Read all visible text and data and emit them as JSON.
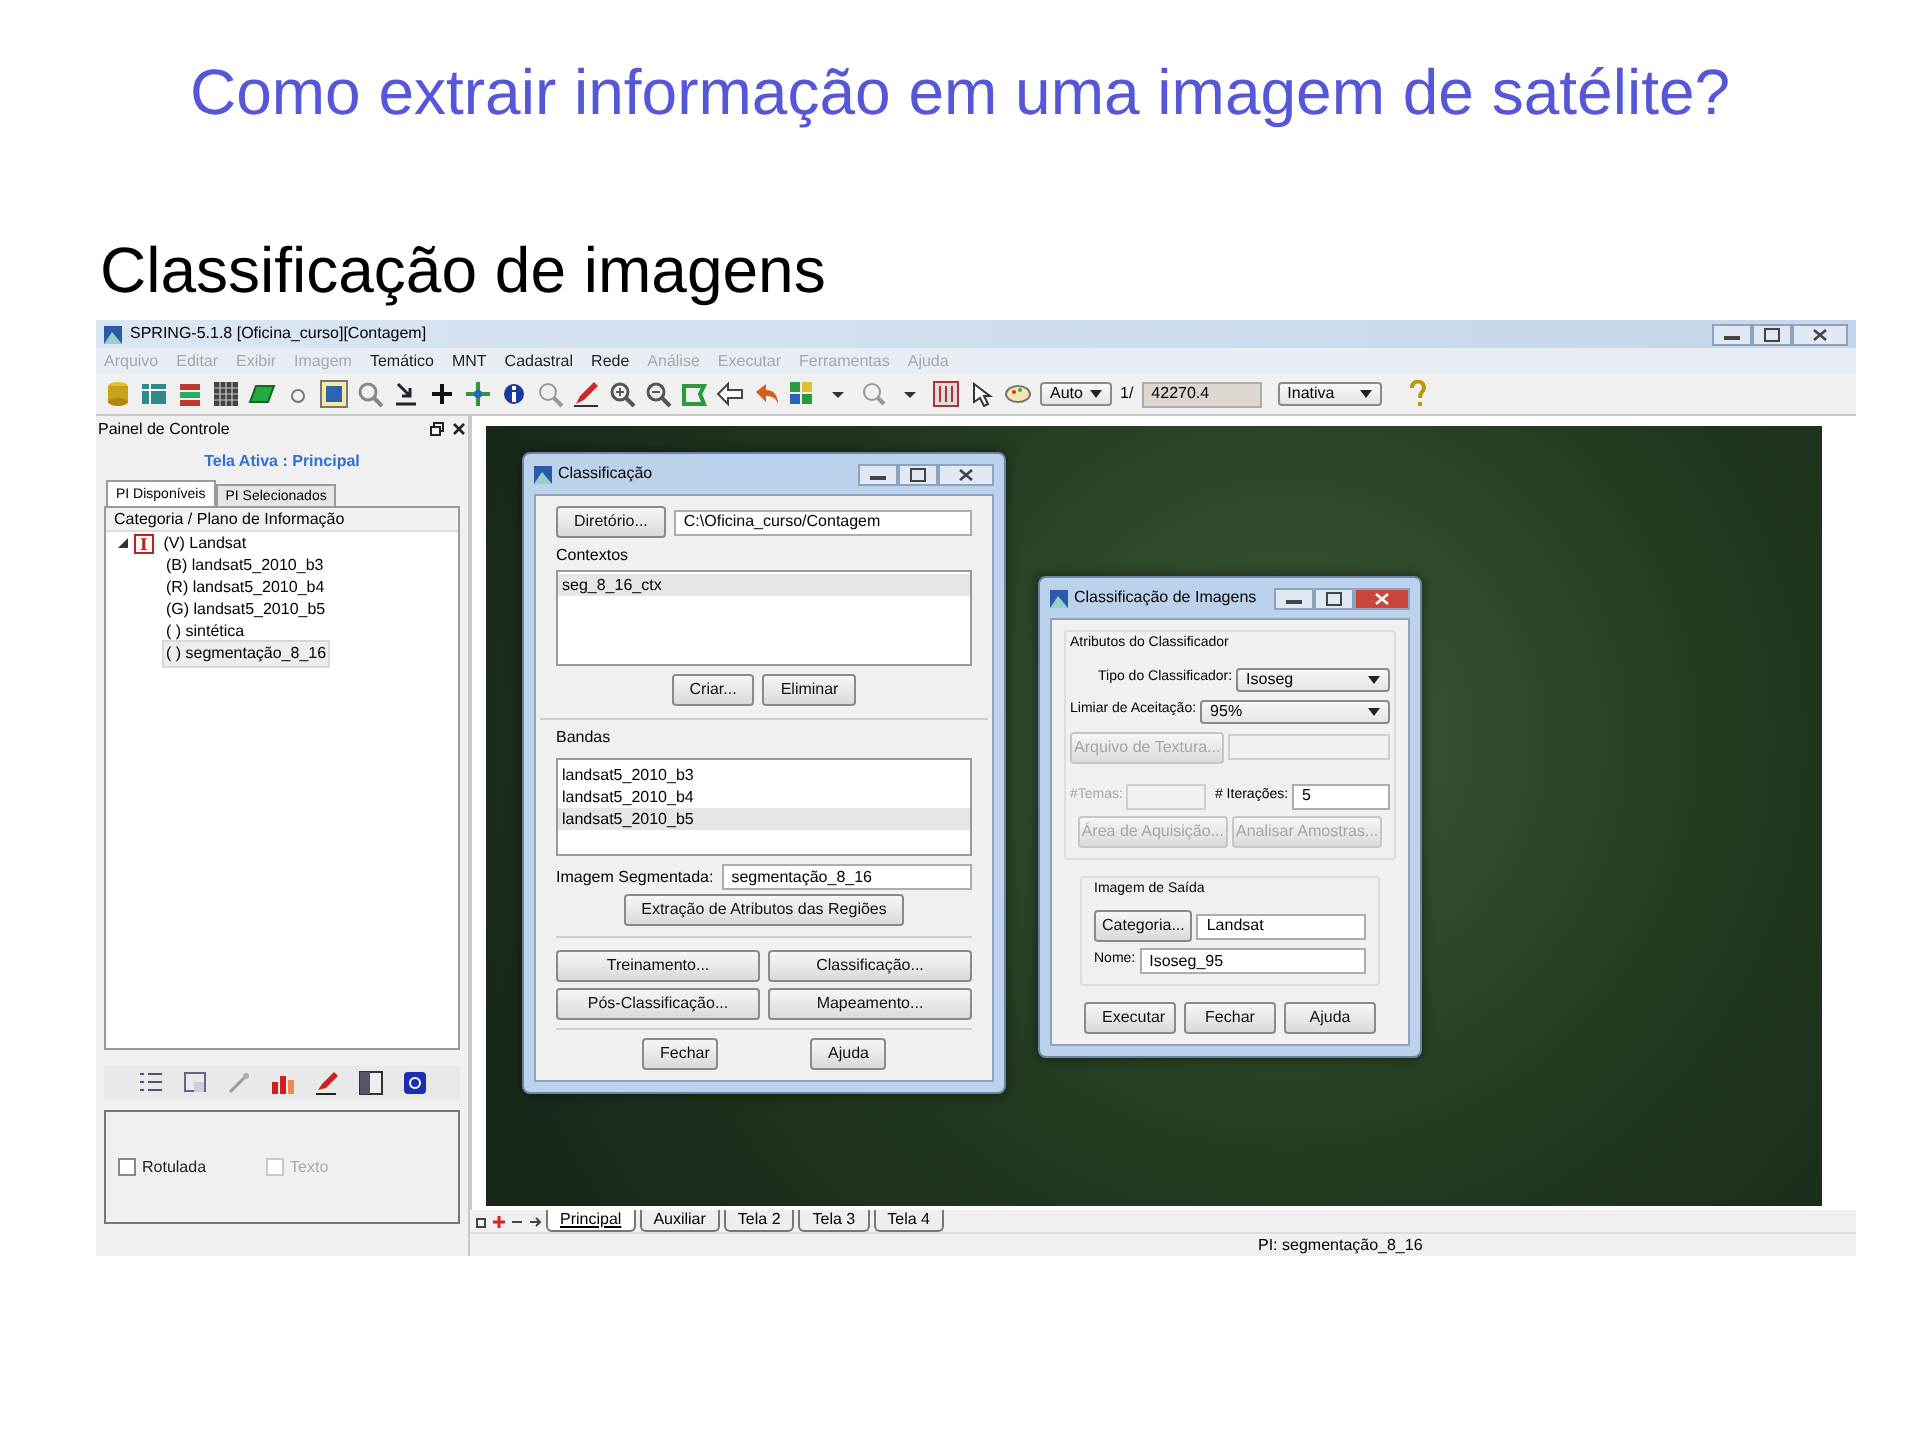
{
  "slide": {
    "title": "Como extrair informação em uma imagem de satélite?",
    "subtitle": "Classificação de imagens"
  },
  "app": {
    "title": "SPRING-5.1.8 [Oficina_curso][Contagem]",
    "menu": [
      {
        "label": "Arquivo",
        "disabled": true
      },
      {
        "label": "Editar",
        "disabled": true
      },
      {
        "label": "Exibir",
        "disabled": true
      },
      {
        "label": "Imagem",
        "disabled": true
      },
      {
        "label": "Temático",
        "disabled": false
      },
      {
        "label": "MNT",
        "disabled": false
      },
      {
        "label": "Cadastral",
        "disabled": false
      },
      {
        "label": "Rede",
        "disabled": false
      },
      {
        "label": "Análise",
        "disabled": true
      },
      {
        "label": "Executar",
        "disabled": true
      },
      {
        "label": "Ferramentas",
        "disabled": true
      },
      {
        "label": "Ajuda",
        "disabled": true
      }
    ],
    "toolbar": {
      "mode": "Auto",
      "scale_prefix": "1/",
      "scale": "42270.4",
      "state": "Inativa"
    },
    "control_panel": {
      "title": "Painel de Controle",
      "active_screen": "Tela Ativa : Principal",
      "tabs": [
        {
          "label": "PI Disponíveis",
          "selected": true
        },
        {
          "label": "PI Selecionados",
          "selected": false
        }
      ],
      "tree_header": "Categoria / Plano de Informação",
      "tree": [
        {
          "icon_letter": "I",
          "label": "(V) Landsat",
          "expanded": true,
          "selected": false,
          "children": [
            {
              "label": "(B) landsat5_2010_b3",
              "selected": false
            },
            {
              "label": "(R) landsat5_2010_b4",
              "selected": false
            },
            {
              "label": "(G) landsat5_2010_b5",
              "selected": false
            },
            {
              "label": "( ) sintética",
              "selected": false
            },
            {
              "label": "( ) segmentação_8_16",
              "selected": true
            }
          ]
        }
      ],
      "checkboxes": [
        {
          "label": "Rotulada",
          "checked": false,
          "disabled": false
        },
        {
          "label": "Texto",
          "checked": false,
          "disabled": true
        }
      ]
    },
    "screen_tabs": [
      {
        "label": "Principal",
        "selected": true
      },
      {
        "label": "Auxiliar",
        "selected": false
      },
      {
        "label": "Tela 2",
        "selected": false
      },
      {
        "label": "Tela 3",
        "selected": false
      },
      {
        "label": "Tela 4",
        "selected": false
      }
    ],
    "status": "PI: segmentação_8_16"
  },
  "classification_dialog": {
    "title": "Classificação",
    "directory_button": "Diretório...",
    "directory": "C:\\Oficina_curso/Contagem",
    "contexts_label": "Contextos",
    "contexts": [
      {
        "label": "seg_8_16_ctx",
        "selected": true
      }
    ],
    "context_buttons": [
      "Criar...",
      "Eliminar"
    ],
    "bands_label": "Bandas",
    "bands": [
      {
        "label": "landsat5_2010_b3",
        "selected": false
      },
      {
        "label": "landsat5_2010_b4",
        "selected": false
      },
      {
        "label": "landsat5_2010_b5",
        "selected": true
      }
    ],
    "segmented_label": "Imagem Segmentada:",
    "segmented": "segmentação_8_16",
    "extract_button": "Extração de Atributos das Regiões",
    "action_buttons": [
      "Treinamento...",
      "Classificação...",
      "Pós-Classificação...",
      "Mapeamento..."
    ],
    "footer_buttons": [
      "Fechar",
      "Ajuda"
    ]
  },
  "image_classification_dialog": {
    "title": "Classificação de Imagens",
    "attributes_group": "Atributos do Classificador",
    "classifier": {
      "label": "Tipo do Classificador:",
      "value": "Isoseg"
    },
    "threshold": {
      "label": "Limiar de Aceitação:",
      "value": "95%"
    },
    "texture_button": {
      "label": "Arquivo de Textura...",
      "disabled": true
    },
    "themes": {
      "label": "#Temas:",
      "disabled": true
    },
    "iterations": {
      "label": "# Iterações:",
      "value": "5"
    },
    "sample_buttons": [
      {
        "label": "Área de Aquisição...",
        "disabled": true
      },
      {
        "label": "Analisar Amostras...",
        "disabled": true
      }
    ],
    "output_group": "Imagem de Saída",
    "category_button": "Categoria...",
    "category": "Landsat",
    "name_label": "Nome:",
    "name": "Isoseg_95",
    "buttons": [
      "Executar",
      "Fechar",
      "Ajuda"
    ]
  }
}
